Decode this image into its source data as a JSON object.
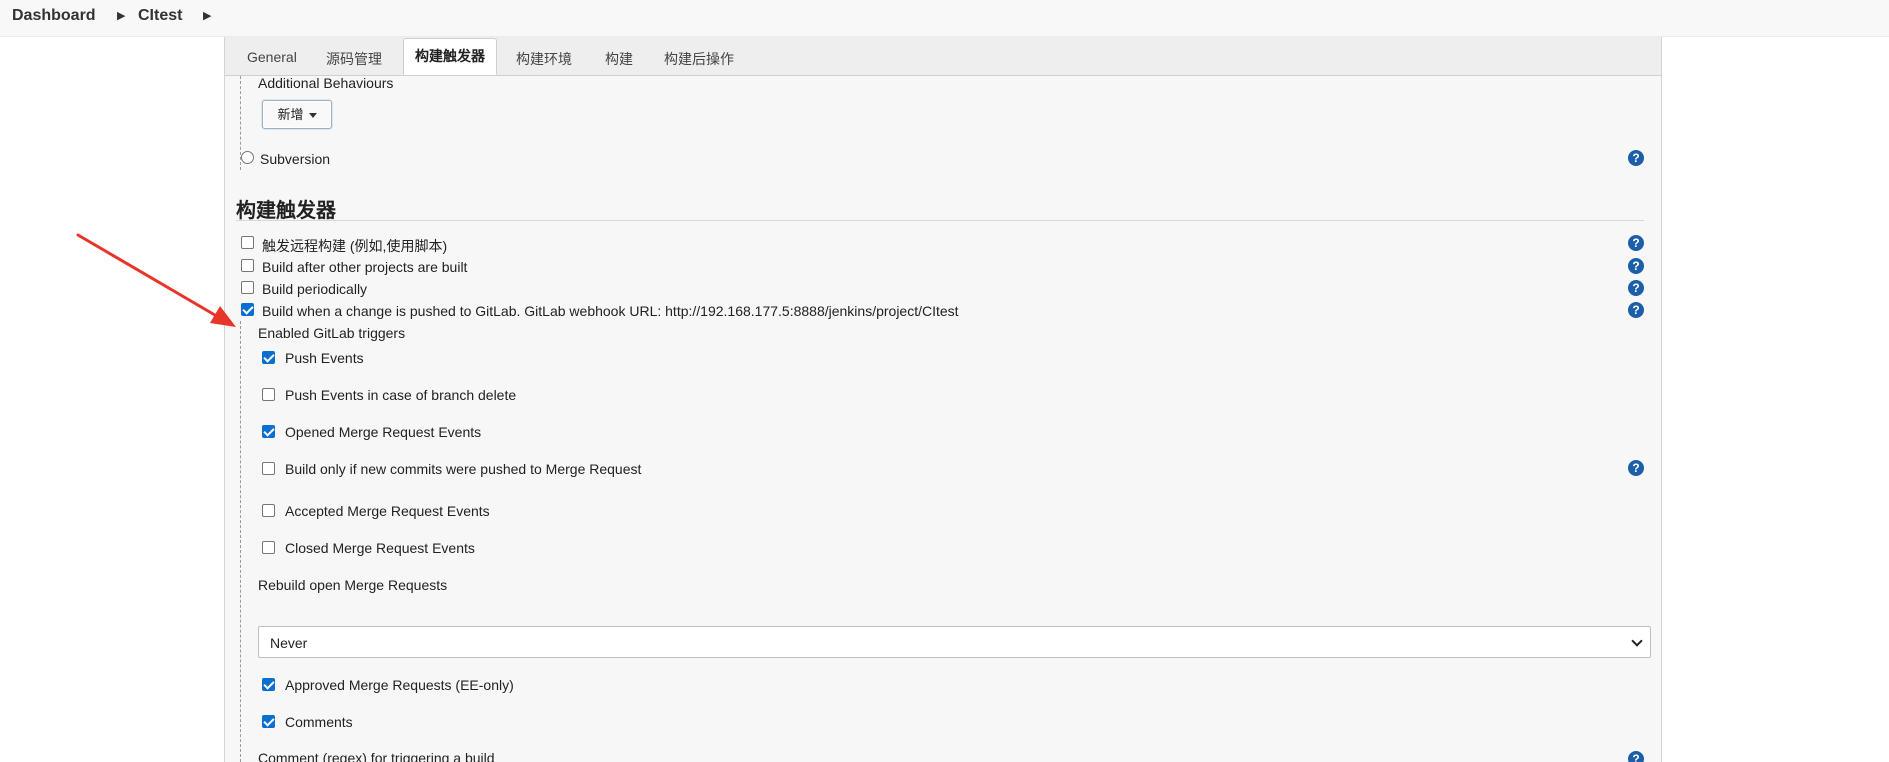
{
  "breadcrumb": {
    "items": [
      "Dashboard",
      "CItest"
    ]
  },
  "tabs": [
    "General",
    "源码管理",
    "构建触发器",
    "构建环境",
    "构建",
    "构建后操作"
  ],
  "scm": {
    "additional_behaviours": "Additional Behaviours",
    "add_button": "新增",
    "subversion": "Subversion"
  },
  "triggers": {
    "title": "构建触发器",
    "options": [
      {
        "label": "触发远程构建 (例如,使用脚本)",
        "checked": false
      },
      {
        "label": "Build after other projects are built",
        "checked": false
      },
      {
        "label": "Build periodically",
        "checked": false
      },
      {
        "label": "Build when a change is pushed to GitLab. GitLab webhook URL: http://192.168.177.5:8888/jenkins/project/CItest",
        "checked": true
      }
    ]
  },
  "gitlab": {
    "enabled_label": "Enabled GitLab triggers",
    "events": [
      {
        "label": "Push Events",
        "checked": true
      },
      {
        "label": "Push Events in case of branch delete",
        "checked": false
      },
      {
        "label": "Opened Merge Request Events",
        "checked": true
      },
      {
        "label": "Build only if new commits were pushed to Merge Request",
        "checked": false
      },
      {
        "label": "Accepted Merge Request Events",
        "checked": false
      },
      {
        "label": "Closed Merge Request Events",
        "checked": false
      }
    ],
    "rebuild_label": "Rebuild open Merge Requests",
    "rebuild_value": "Never",
    "extra": [
      {
        "label": "Approved Merge Requests (EE-only)",
        "checked": true
      },
      {
        "label": "Comments",
        "checked": true
      }
    ],
    "comment_regex_label": "Comment (regex) for triggering a build"
  },
  "help_icon_glyph": "?",
  "colors": {
    "accent": "#0b6fd0",
    "help": "#1b5fa8",
    "arrow": "#e8352a"
  }
}
